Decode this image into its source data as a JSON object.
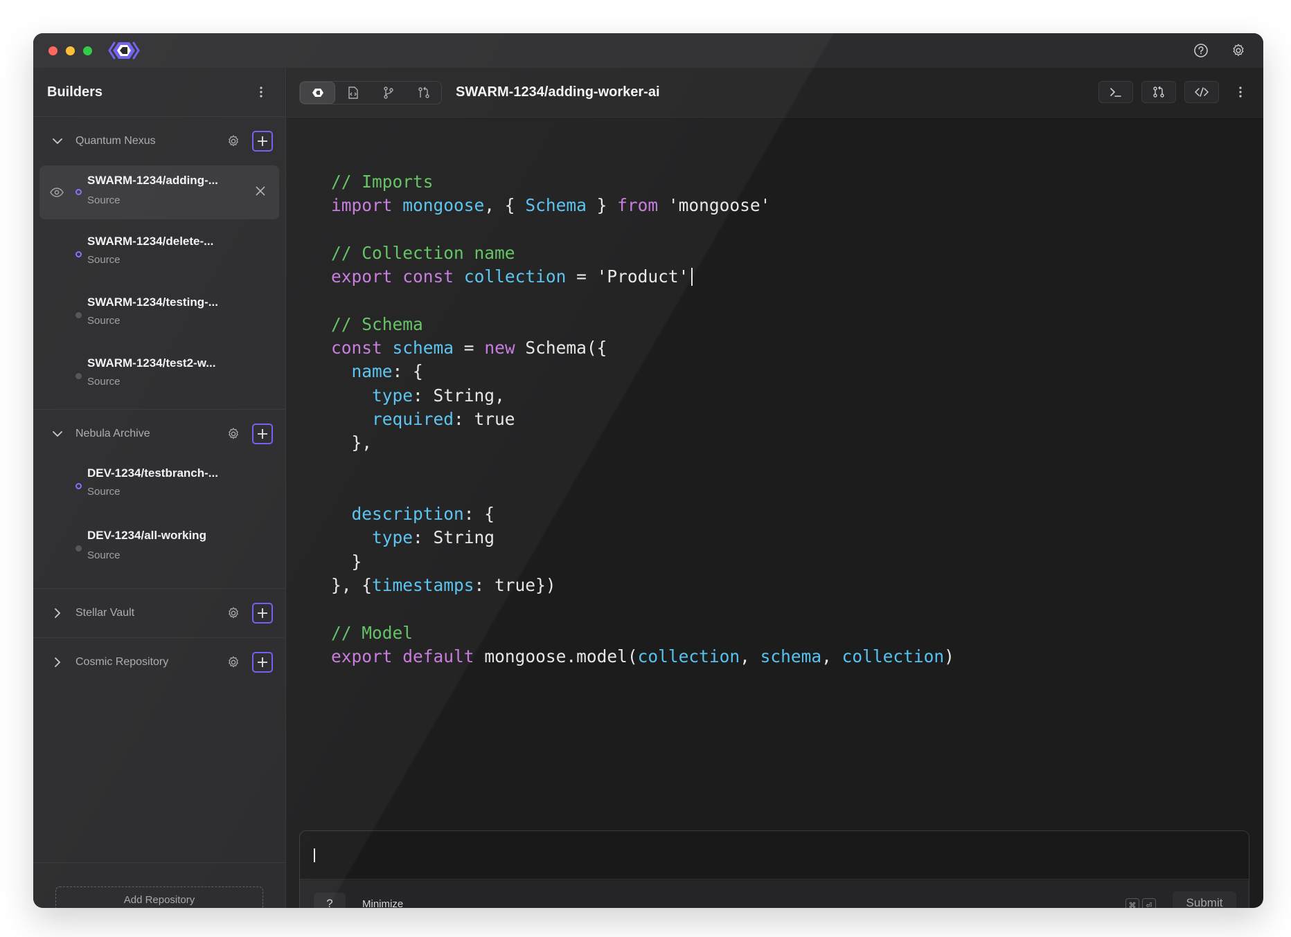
{
  "colors": {
    "accent": "#6b5cf0",
    "traffic_red": "#ff5f57",
    "traffic_yellow": "#febc2e",
    "traffic_green": "#28c840",
    "code_comment": "#5fc15f",
    "code_keyword": "#c678dd",
    "code_identifier": "#56c2f0"
  },
  "titlebar": {
    "icons": [
      "help-icon",
      "gear-icon"
    ]
  },
  "sidebar": {
    "title": "Builders",
    "groups": [
      {
        "name": "Quantum Nexus",
        "expanded": true,
        "items": [
          {
            "name": "SWARM-1234/adding-...",
            "sub": "Source",
            "status": "active"
          },
          {
            "name": "SWARM-1234/delete-...",
            "sub": "Source",
            "status": "active"
          },
          {
            "name": "SWARM-1234/testing-...",
            "sub": "Source",
            "status": "inactive"
          },
          {
            "name": "SWARM-1234/test2-w...",
            "sub": "Source",
            "status": "inactive"
          }
        ]
      },
      {
        "name": "Nebula Archive",
        "expanded": true,
        "items": [
          {
            "name": "DEV-1234/testbranch-...",
            "sub": "Source",
            "status": "active"
          },
          {
            "name": "DEV-1234/all-working",
            "sub": "Source",
            "status": "inactive"
          }
        ]
      },
      {
        "name": "Stellar Vault",
        "expanded": false,
        "items": []
      },
      {
        "name": "Cosmic Repository",
        "expanded": false,
        "items": []
      }
    ],
    "add_repository": "Add Repository"
  },
  "toolbar": {
    "branch_title": "SWARM-1234/adding-worker-ai",
    "left_icons": [
      "swarm-logo-icon",
      "file-code-icon",
      "git-branch-icon",
      "git-compare-icon"
    ],
    "right_icons": [
      "terminal-icon",
      "pull-request-icon",
      "code-icon",
      "more-icon"
    ]
  },
  "code": {
    "c1": "// Imports",
    "c2": "// Collection name",
    "c3": "// Schema",
    "c4": "// Model",
    "import_kw": "import",
    "mongoose": "mongoose",
    "schema_name": "Schema",
    "from_kw": "from",
    "mongoose_str": "'mongoose'",
    "export_kw": "export",
    "const_kw": "const",
    "collection": "collection",
    "product_str": "'Product'",
    "schema_var": "schema",
    "new_kw": "new",
    "schema_call": "Schema({",
    "name_key": "name",
    "type_key": "type",
    "required_key": "required",
    "string_val": "String",
    "true_val": "true",
    "description_key": "description",
    "timestamps_key": "timestamps",
    "default_kw": "default",
    "model_call": "mongoose.model("
  },
  "prompt": {
    "help_label": "?",
    "minimize_label": "Minimize",
    "kbd_cmd": "⌘",
    "kbd_enter": "⏎",
    "submit_label": "Submit"
  }
}
